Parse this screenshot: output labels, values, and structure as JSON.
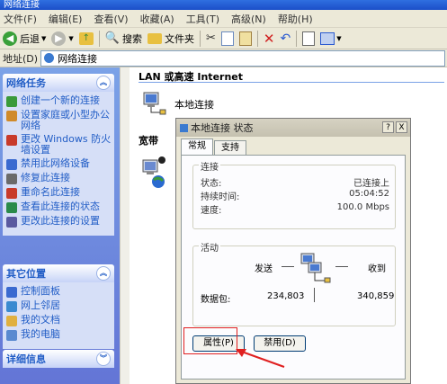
{
  "window": {
    "title": "网络连接"
  },
  "menu": [
    "文件(F)",
    "编辑(E)",
    "查看(V)",
    "收藏(A)",
    "工具(T)",
    "高级(N)",
    "帮助(H)"
  ],
  "toolbar": {
    "back": "后退",
    "search": "搜索",
    "folders": "文件夹"
  },
  "address": {
    "label": "地址(D)",
    "value": "网络连接"
  },
  "network_tasks": {
    "title": "网络任务",
    "items": [
      {
        "label": "创建一个新的连接",
        "icon": "new-connection-icon",
        "color": "#3a9a3a"
      },
      {
        "label": "设置家庭或小型办公网络",
        "icon": "home-network-icon",
        "color": "#d08a2a"
      },
      {
        "label": "更改 Windows 防火墙设置",
        "icon": "firewall-icon",
        "color": "#c83a2a"
      },
      {
        "label": "禁用此网络设备",
        "icon": "disable-device-icon",
        "color": "#3a6ad0"
      },
      {
        "label": "修复此连接",
        "icon": "repair-icon",
        "color": "#6a6a6a"
      },
      {
        "label": "重命名此连接",
        "icon": "rename-icon",
        "color": "#c83a2a"
      },
      {
        "label": "查看此连接的状态",
        "icon": "status-icon",
        "color": "#2a8a4a"
      },
      {
        "label": "更改此连接的设置",
        "icon": "settings-icon",
        "color": "#5a5aa0"
      }
    ]
  },
  "other_places": {
    "title": "其它位置",
    "items": [
      {
        "label": "控制面板",
        "icon": "control-panel-icon",
        "color": "#3a6ad0"
      },
      {
        "label": "网上邻居",
        "icon": "network-places-icon",
        "color": "#3a8ad0"
      },
      {
        "label": "我的文档",
        "icon": "my-documents-icon",
        "color": "#e0b040"
      },
      {
        "label": "我的电脑",
        "icon": "my-computer-icon",
        "color": "#5a8ad0"
      }
    ]
  },
  "details": {
    "title": "详细信息"
  },
  "main": {
    "lan_header": "LAN 或高速 Internet",
    "local_connection": "本地连接",
    "broadband_header": "宽带"
  },
  "dialog": {
    "title": "本地连接 状态",
    "help": "?",
    "close": "X",
    "tabs": [
      "常规",
      "支持"
    ],
    "connection_group": "连接",
    "status_label": "状态:",
    "status_value": "已连接上",
    "duration_label": "持续时间:",
    "duration_value": "05:04:52",
    "speed_label": "速度:",
    "speed_value": "100.0 Mbps",
    "activity_group": "活动",
    "sent_label": "发送",
    "received_label": "收到",
    "packets_label": "数据包:",
    "packets_sent": "234,803",
    "packets_received": "340,859",
    "properties_button": "属性(P)",
    "disable_button": "禁用(D)"
  },
  "colors": {
    "accent": "#215dc6",
    "highlight": "#e02020"
  }
}
